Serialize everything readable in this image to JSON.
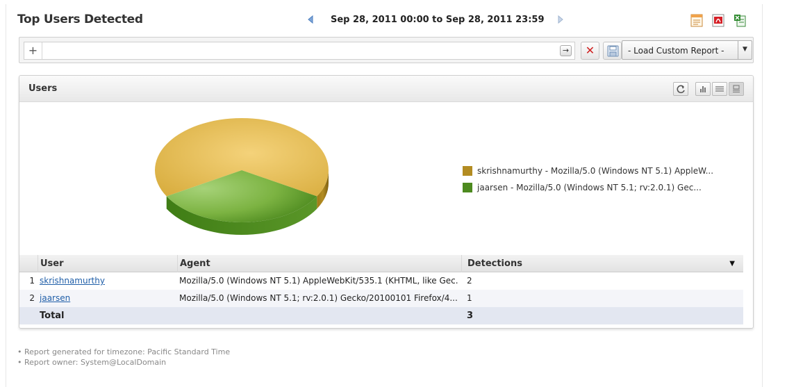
{
  "header": {
    "title": "Top Users Detected",
    "date_range": "Sep 28, 2011 00:00 to Sep 28, 2011 23:59"
  },
  "filter_bar": {
    "plus_label": "+",
    "input_value": "",
    "go_label": "→",
    "clear_label": "✕",
    "load_report_label": "- Load Custom Report -"
  },
  "panel": {
    "title": "Users",
    "tools": [
      "refresh-icon",
      "bar-chart-icon",
      "table-view-icon",
      "chart-table-icon"
    ]
  },
  "chart_data": {
    "type": "pie",
    "series": [
      {
        "name": "skrishnamurthy - Mozilla/5.0 (Windows NT 5.1) AppleW...",
        "value": 2,
        "color": "#e3bd52"
      },
      {
        "name": "jaarsen - Mozilla/5.0 (Windows NT 5.1; rv:2.0.1) Gec...",
        "value": 1,
        "color": "#7cb342"
      }
    ]
  },
  "table": {
    "columns": [
      "User",
      "Agent",
      "Detections"
    ],
    "rows": [
      {
        "num": "1",
        "user": "skrishnamurthy",
        "agent": "Mozilla/5.0 (Windows NT 5.1) AppleWebKit/535.1 (KHTML, like Gec...",
        "detections": "2",
        "bar_fraction": 1.0
      },
      {
        "num": "2",
        "user": "jaarsen",
        "agent": "Mozilla/5.0 (Windows NT 5.1; rv:2.0.1) Gecko/20100101 Firefox/4...",
        "detections": "1",
        "bar_fraction": 0.5
      }
    ],
    "total_label": "Total",
    "total_value": "3"
  },
  "footer": {
    "timezone": "• Report generated for timezone: Pacific Standard Time",
    "owner": "• Report owner: System@LocalDomain"
  }
}
